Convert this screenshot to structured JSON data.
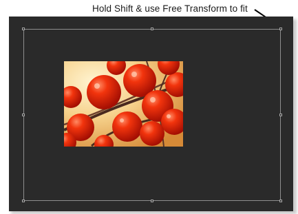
{
  "annotation": {
    "text": "Hold Shift & use Free Transform to fit"
  },
  "colors": {
    "canvas_background": "#2a2a2a",
    "transform_box_border": "#8f8f8f",
    "photo_background": "#f4d79a",
    "berry_red": "#e0230a"
  },
  "icons": {
    "photo": "red-berries-photo"
  }
}
